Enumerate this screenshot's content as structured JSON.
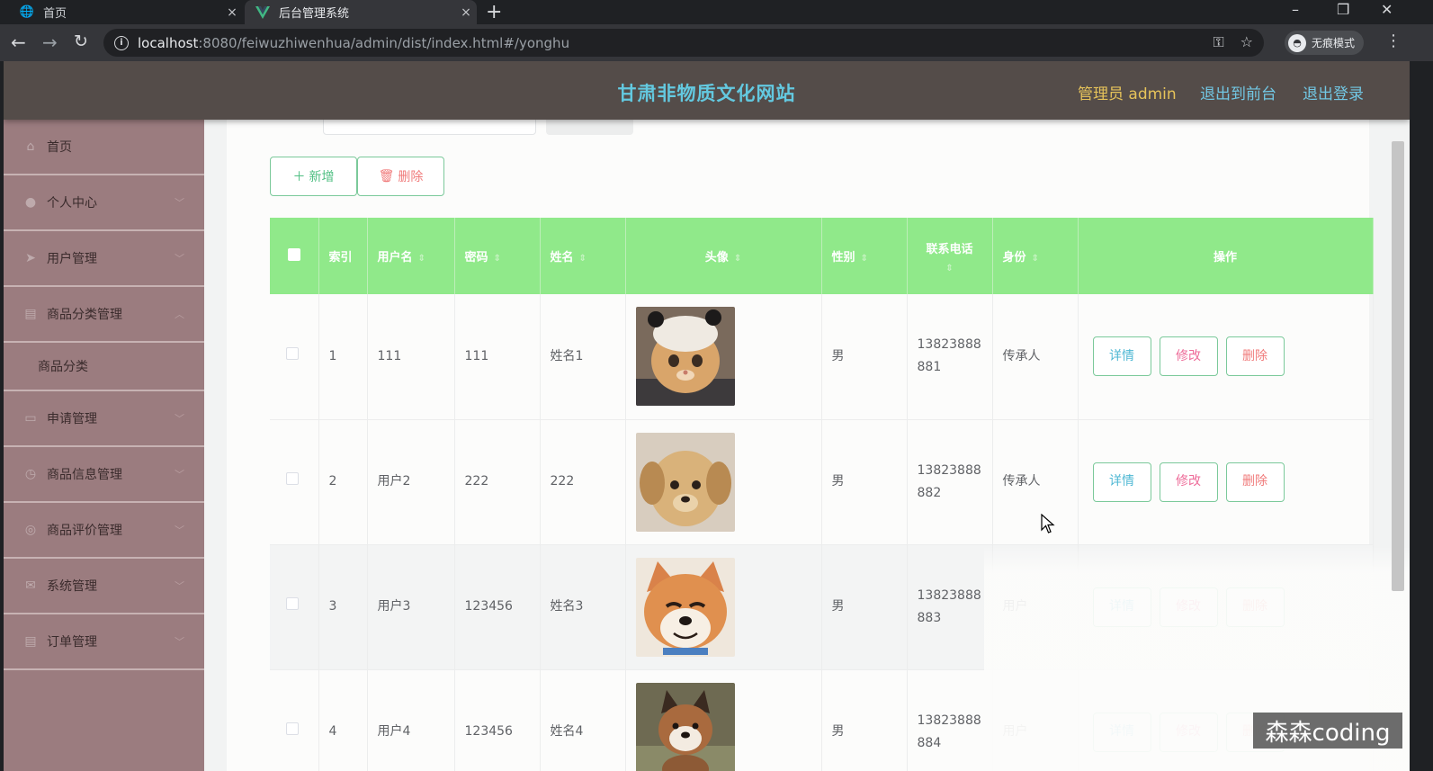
{
  "browser": {
    "tabs": [
      {
        "title": "首页",
        "close": "×"
      },
      {
        "title": "后台管理系统",
        "close": "×"
      }
    ],
    "new_tab": "+",
    "url_host": "localhost",
    "url_rest": ":8080/feiwuzhiwenhua/admin/dist/index.html#/yonghu",
    "incognito_label": "无痕模式",
    "window_controls": [
      "–",
      "❐",
      "✕"
    ]
  },
  "header": {
    "title": "甘肃非物质文化网站",
    "user_label": "管理员 admin",
    "back_to_front": "退出到前台",
    "logout": "退出登录"
  },
  "sidebar": {
    "items": [
      {
        "label": "首页",
        "icon": "home-icon"
      },
      {
        "label": "个人中心",
        "icon": "user-icon"
      },
      {
        "label": "用户管理",
        "icon": "send-icon"
      },
      {
        "label": "商品分类管理",
        "icon": "clipboard-icon"
      },
      {
        "label": "商品分类",
        "icon": ""
      },
      {
        "label": "申请管理",
        "icon": "briefcase-icon"
      },
      {
        "label": "商品信息管理",
        "icon": "clock-icon"
      },
      {
        "label": "商品评价管理",
        "icon": "compass-icon"
      },
      {
        "label": "系统管理",
        "icon": "mail-icon"
      },
      {
        "label": "订单管理",
        "icon": "clipboard-icon"
      }
    ]
  },
  "toolbar": {
    "add_label": "新增",
    "delete_label": "删除"
  },
  "table": {
    "headers": [
      "索引",
      "用户名",
      "密码",
      "姓名",
      "头像",
      "性别",
      "联系电话",
      "身份",
      "操作"
    ],
    "rows": [
      {
        "index": "1",
        "username": "111",
        "password": "111",
        "name": "姓名1",
        "avatar": "cat",
        "gender": "男",
        "phone_a": "13823888",
        "phone_b": "881",
        "role": "传承人"
      },
      {
        "index": "2",
        "username": "用户2",
        "password": "222",
        "name": "222",
        "avatar": "puppy",
        "gender": "男",
        "phone_a": "13823888",
        "phone_b": "882",
        "role": "传承人"
      },
      {
        "index": "3",
        "username": "用户3",
        "password": "123456",
        "name": "姓名3",
        "avatar": "shiba",
        "gender": "男",
        "phone_a": "13823888",
        "phone_b": "883",
        "role": "用户"
      },
      {
        "index": "4",
        "username": "用户4",
        "password": "123456",
        "name": "姓名4",
        "avatar": "shiba-grass",
        "gender": "男",
        "phone_a": "13823888",
        "phone_b": "884",
        "role": "用户"
      }
    ],
    "row_actions": {
      "detail": "详情",
      "edit": "修改",
      "remove": "删除"
    }
  },
  "watermark": "森森coding",
  "colors": {
    "header_bg": "#544c49",
    "sidebar_bg": "#9b7c7f",
    "table_header_bg": "#90e98a",
    "brand_title": "#63c9e0",
    "user_label": "#e6c35a",
    "link": "#72c7e4"
  }
}
